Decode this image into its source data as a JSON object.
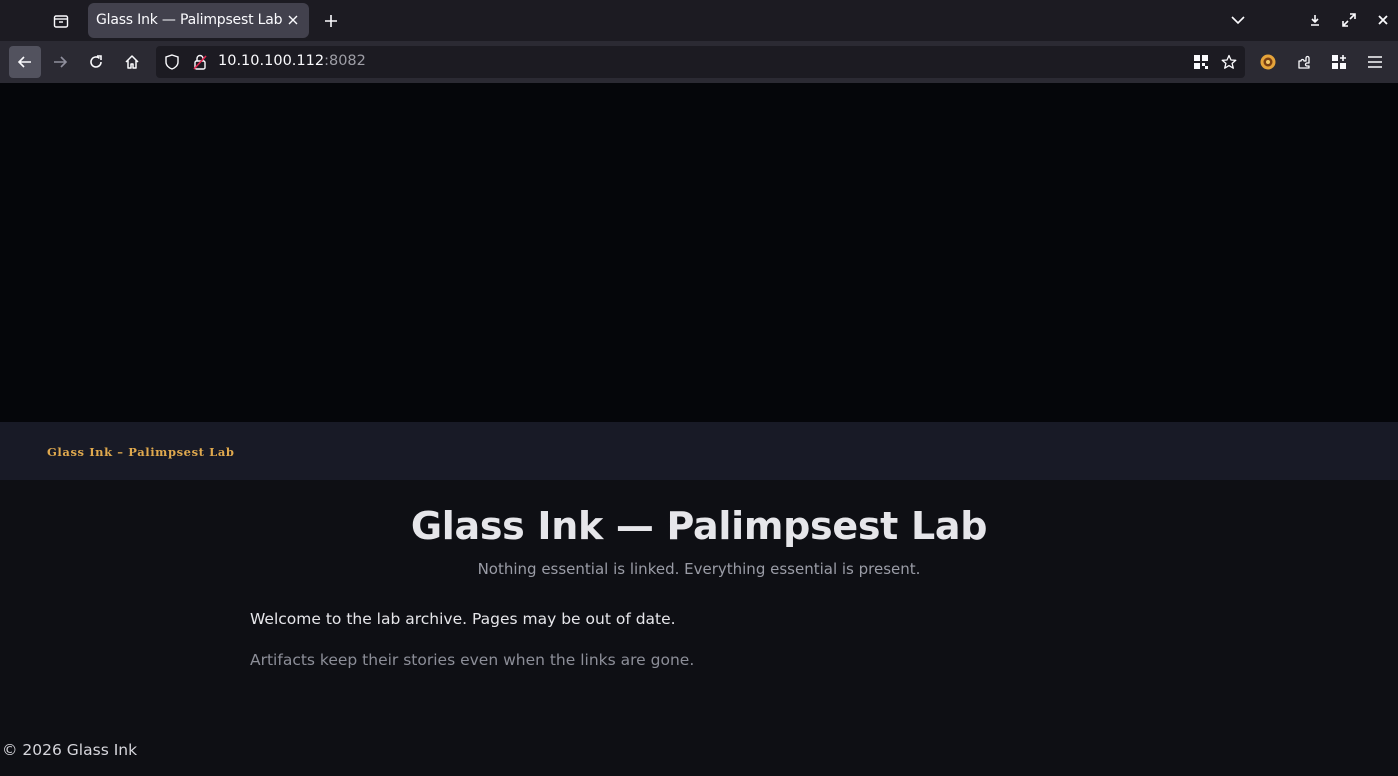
{
  "browser": {
    "tab": {
      "title": "Glass Ink — Palimpsest Lab"
    },
    "url": {
      "host": "10.10.100.112",
      "port": ":8082"
    }
  },
  "page": {
    "banner_brand": "Glass Ink – Palimpsest Lab",
    "title": "Glass Ink — Palimpsest Lab",
    "tagline": "Nothing essential is linked. Everything essential is present.",
    "para1": "Welcome to the lab archive. Pages may be out of date.",
    "para2": "Artifacts keep their stories even when the links are gone.",
    "footer": "© 2026 Glass Ink"
  },
  "colors": {
    "accent": "#e0a94e",
    "page_bg": "#0e0f14",
    "banner_bg": "#181a26"
  }
}
